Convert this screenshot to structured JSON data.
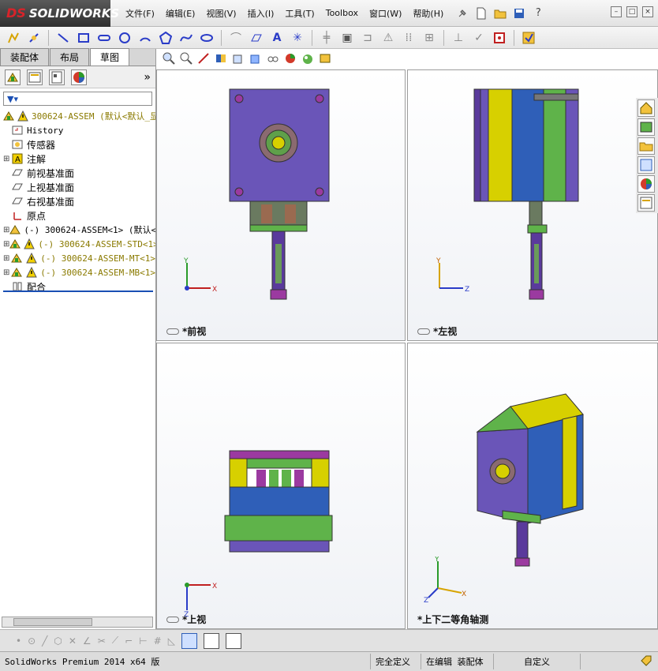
{
  "app": {
    "logo_ds": "DS",
    "logo_text": "SOLIDWORKS"
  },
  "menu": [
    "文件(F)",
    "编辑(E)",
    "视图(V)",
    "插入(I)",
    "工具(T)",
    "Toolbox",
    "窗口(W)",
    "帮助(H)"
  ],
  "left_tabs": [
    "装配体",
    "布局",
    "草图"
  ],
  "tree": {
    "root_label": "300624-ASSEM  (默认<默认_显",
    "items": [
      {
        "label": "History",
        "mono": true,
        "icon": "history-icon"
      },
      {
        "label": "传感器",
        "icon": "sensor-icon"
      },
      {
        "label": "注解",
        "icon": "annotation-icon",
        "expand": true
      },
      {
        "label": "前视基准面",
        "icon": "plane-icon"
      },
      {
        "label": "上视基准面",
        "icon": "plane-icon"
      },
      {
        "label": "右视基准面",
        "icon": "plane-icon"
      },
      {
        "label": "原点",
        "icon": "origin-icon"
      },
      {
        "label": "(-) 300624-ASSEM<1> (默认<",
        "mono": true,
        "icon": "part-icon",
        "expand": true
      },
      {
        "label": "(-) 300624-ASSEM-STD<1>",
        "mono": true,
        "icon": "part-warning-icon",
        "expand": true,
        "yellow": true
      },
      {
        "label": "(-) 300624-ASSEM-MT<1>",
        "mono": true,
        "icon": "part-warning-icon",
        "expand": true,
        "yellow": true
      },
      {
        "label": "(-) 300624-ASSEM-MB<1>",
        "mono": true,
        "icon": "part-warning-icon",
        "expand": true,
        "yellow": true
      },
      {
        "label": "配合",
        "icon": "mates-icon"
      }
    ]
  },
  "viewports": {
    "front": "*前视",
    "left": "*左视",
    "top": "*上视",
    "iso": "*上下二等角轴测"
  },
  "axis_labels": {
    "x": "X",
    "y": "Y",
    "z": "Z"
  },
  "status": {
    "product": "SolidWorks Premium 2014 x64 版",
    "defined": "完全定义",
    "editing": "在编辑 装配体",
    "custom": "自定义"
  },
  "colors": {
    "purple": "#6a55b8",
    "yellow": "#d7d000",
    "green": "#5fb34a",
    "blue": "#2f5fb8",
    "dark_purple": "#5a3a9c"
  }
}
